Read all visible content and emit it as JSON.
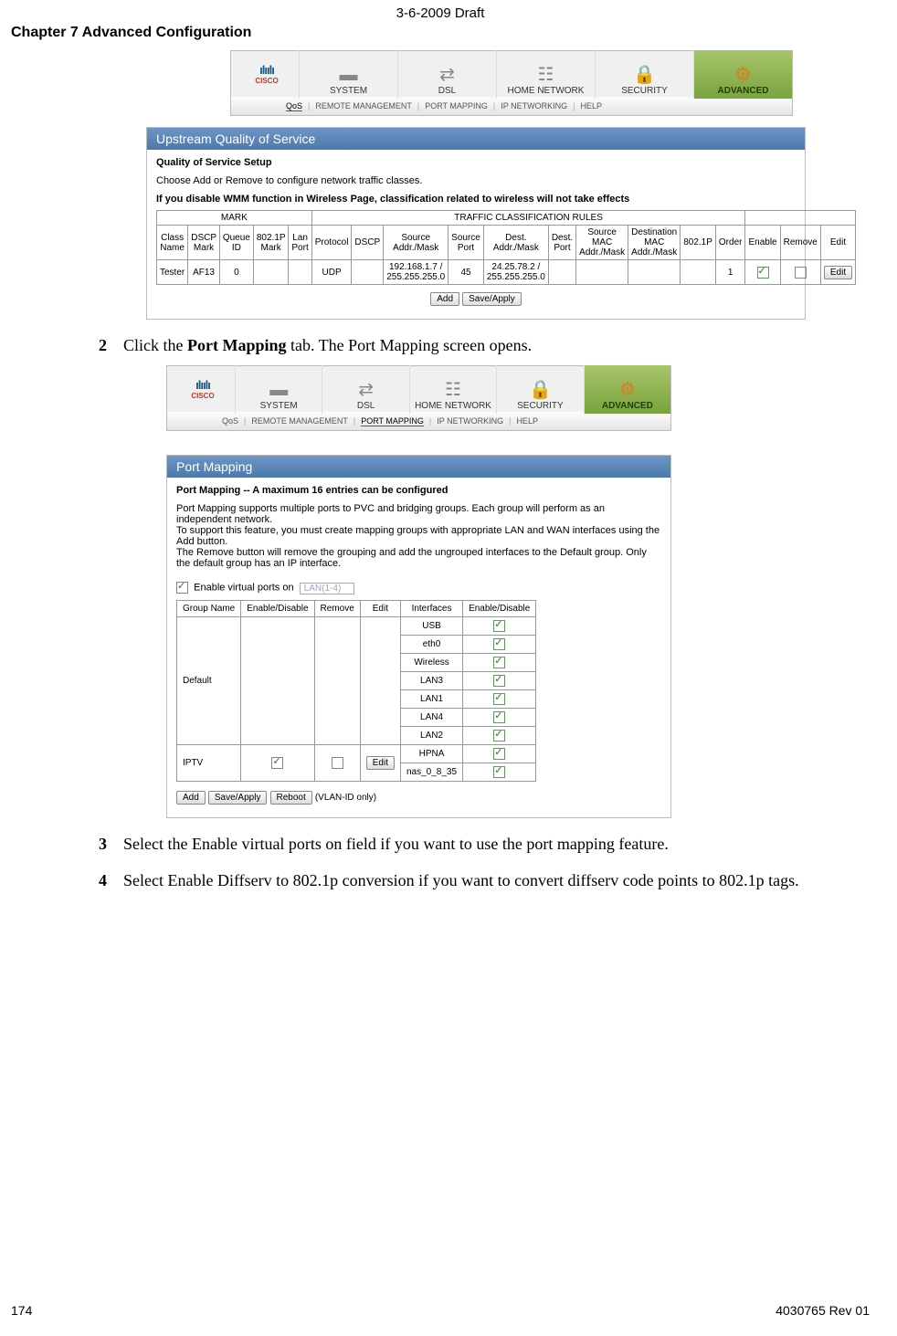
{
  "header": {
    "draft": "3-6-2009 Draft",
    "chapter": "Chapter 7    Advanced Configuration"
  },
  "nav": {
    "brand_bars": "ılıılı",
    "brand_text": "CISCO",
    "tabs": {
      "system": "SYSTEM",
      "dsl": "DSL",
      "home": "HOME NETWORK",
      "security": "SECURITY",
      "advanced": "ADVANCED"
    },
    "subnav1": {
      "qos": "QoS",
      "remote": "REMOTE MANAGEMENT",
      "pm": "PORT MAPPING",
      "ip": "IP NETWORKING",
      "help": "HELP"
    },
    "subnav2": {
      "qos": "QoS",
      "remote": "REMOTE MANAGEMENT",
      "pm": "PORT MAPPING",
      "ip": "IP NETWORKING",
      "help": "HELP"
    }
  },
  "qos": {
    "header": "Upstream Quality of Service",
    "title": "Quality of Service Setup",
    "intro": "Choose Add or Remove to configure network traffic classes.",
    "warn": "If you disable WMM function in Wireless Page, classification related to wireless will not take effects",
    "groupMark": "MARK",
    "groupRules": "TRAFFIC CLASSIFICATION RULES",
    "cols": {
      "cname": "Class Name",
      "dscpmark": "DSCP Mark",
      "qid": "Queue ID",
      "p8021": "802.1P Mark",
      "lanport": "Lan Port",
      "proto": "Protocol",
      "dscp": "DSCP",
      "srcaddr": "Source Addr./Mask",
      "srcport": "Source Port",
      "dstaddr": "Dest. Addr./Mask",
      "dstport": "Dest. Port",
      "srcmac": "Source MAC Addr./Mask",
      "dstmac": "Destination MAC Addr./Mask",
      "p8021b": "802.1P",
      "order": "Order",
      "enable": "Enable",
      "remove": "Remove",
      "edit": "Edit"
    },
    "row": {
      "cname": "Tester",
      "dscpmark": "AF13",
      "qid": "0",
      "p8021": "",
      "lanport": "",
      "proto": "UDP",
      "dscp": "",
      "srcaddr": "192.168.1.7 / 255.255.255.0",
      "srcport": "45",
      "dstaddr": "24.25.78.2 / 255.255.255.0",
      "dstport": "",
      "srcmac": "",
      "dstmac": "",
      "p8021b": "",
      "order": "1",
      "edit": "Edit"
    },
    "add": "Add",
    "save": "Save/Apply"
  },
  "step2": {
    "num": "2",
    "textA": "Click the ",
    "bold": "Port Mapping",
    "textB": " tab. The Port Mapping screen opens."
  },
  "pm": {
    "header": "Port Mapping",
    "title": "Port Mapping -- A maximum 16 entries can be configured",
    "d1": "Port Mapping supports multiple ports to PVC and bridging groups. Each group will perform as an independent network.",
    "d2": "To support this feature, you must create mapping groups with appropriate LAN and WAN interfaces using the Add button.",
    "d3": "The Remove button will remove the grouping and add the ungrouped interfaces to the Default group. Only the default group has an IP interface.",
    "enable_label": "Enable virtual ports on",
    "enable_field": "LAN(1-4)",
    "cols": {
      "gname": "Group Name",
      "ed": "Enable/Disable",
      "rm": "Remove",
      "edit": "Edit",
      "if": "Interfaces",
      "ed2": "Enable/Disable"
    },
    "g_default": "Default",
    "g_iptv": "IPTV",
    "ifs": {
      "usb": "USB",
      "eth0": "eth0",
      "wl": "Wireless",
      "lan3": "LAN3",
      "lan1": "LAN1",
      "lan4": "LAN4",
      "lan2": "LAN2",
      "hpna": "HPNA",
      "nas": "nas_0_8_35"
    },
    "edit": "Edit",
    "add": "Add",
    "save": "Save/Apply",
    "reboot": "Reboot",
    "note": "(VLAN-ID only)"
  },
  "step3": {
    "num": "3",
    "text": "Select the Enable virtual ports on field if you want to use the port mapping feature."
  },
  "step4": {
    "num": "4",
    "text": "Select Enable Diffserv to 802.1p conversion if you want to convert diffserv code points to 802.1p tags."
  },
  "footer": {
    "pageno": "174",
    "docid": "4030765 Rev 01"
  }
}
